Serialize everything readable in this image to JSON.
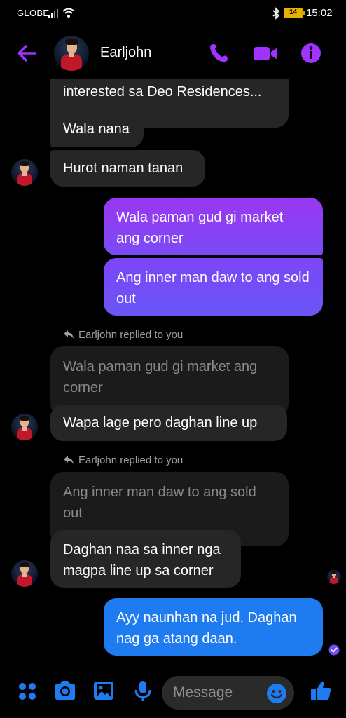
{
  "status": {
    "carrier": "GLOBE",
    "battery": "14",
    "time": "15:02"
  },
  "header": {
    "contact_name": "Earljohn"
  },
  "messages": {
    "m0": "interested sa Deo Residences...",
    "m1": "Wala nana",
    "m2": "Hurot naman tanan",
    "m3": "Wala paman gud gi market ang corner",
    "m4": "Ang inner man daw to ang sold out",
    "r1_label": "Earljohn replied to you",
    "r1_quote": "Wala paman gud gi market ang corner",
    "r1_text": "Wapa lage pero daghan line up",
    "r2_label": "Earljohn replied to you",
    "r2_quote": "Ang inner man daw to ang sold out",
    "r2_text": "Daghan naa sa inner nga magpa line up sa corner",
    "m5": "Ayy naunhan na jud. Daghan nag ga atang daan."
  },
  "composer": {
    "placeholder": "Message"
  },
  "colors": {
    "accent": "#a033ff",
    "blue": "#1f7cf0",
    "incoming": "#262626"
  },
  "icons": [
    "back-arrow-icon",
    "phone-icon",
    "video-icon",
    "info-icon",
    "apps-icon",
    "camera-icon",
    "gallery-icon",
    "mic-icon",
    "emoji-icon",
    "thumbs-up-icon",
    "reply-arrow-icon",
    "seen-check-icon"
  ]
}
